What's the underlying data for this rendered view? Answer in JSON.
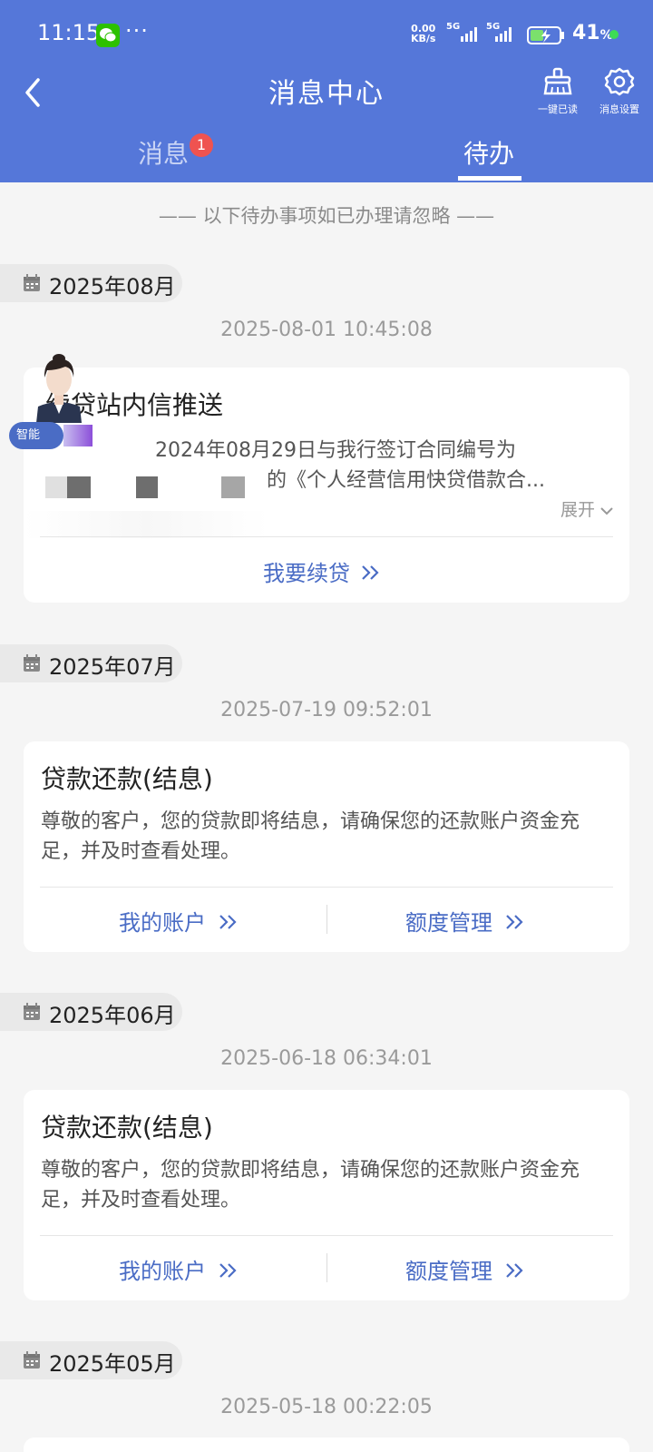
{
  "status_bar": {
    "time": "11:15",
    "dots": "···",
    "net_speed_value": "0.00",
    "net_speed_unit": "KB/s",
    "battery_percent": "41",
    "percent_sign": "%",
    "signal_1": "5G",
    "signal_2": "5G"
  },
  "nav": {
    "title": "消息中心",
    "read_all_label": "一键已读",
    "settings_label": "消息设置"
  },
  "tabs": [
    {
      "label": "消息",
      "badge": "1"
    },
    {
      "label": "待办"
    }
  ],
  "notice": "—— 以下待办事项如已办理请忽略 ——",
  "ai_tag": "智能",
  "groups": [
    {
      "month": "2025年08月",
      "timestamp": "2025-08-01 10:45:08",
      "card": {
        "title": "续贷站内信推送",
        "body_line1": "2024年08月29日与我行签订合同编号为",
        "body_line2": "的《个人经营信用快贷借款合...",
        "expand_label": "展开",
        "action": "我要续贷"
      }
    },
    {
      "month": "2025年07月",
      "timestamp": "2025-07-19 09:52:01",
      "card": {
        "title": "贷款还款(结息)",
        "body": "尊敬的客户，您的贷款即将结息，请确保您的还款账户资金充足，并及时查看处理。",
        "action_left": "我的账户",
        "action_right": "额度管理"
      }
    },
    {
      "month": "2025年06月",
      "timestamp": "2025-06-18 06:34:01",
      "card": {
        "title": "贷款还款(结息)",
        "body": "尊敬的客户，您的贷款即将结息，请确保您的还款账户资金充足，并及时查看处理。",
        "action_left": "我的账户",
        "action_right": "额度管理"
      }
    },
    {
      "month": "2025年05月",
      "timestamp": "2025-05-18 00:22:05"
    }
  ],
  "colors": {
    "header_bg": "#5577d9",
    "link": "#4a6cc5",
    "badge": "#ef5350"
  }
}
